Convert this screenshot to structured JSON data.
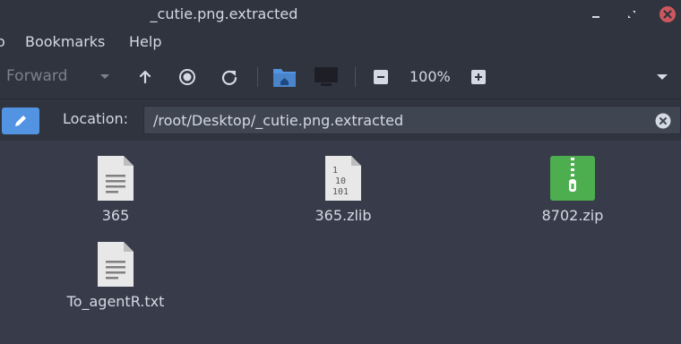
{
  "window": {
    "title": "_cutie.png.extracted"
  },
  "menubar": {
    "items": [
      "o",
      "Bookmarks",
      "Help"
    ]
  },
  "toolbar": {
    "forward_label": "Forward",
    "zoom_level": "100%"
  },
  "location": {
    "label": "Location:",
    "value": "/root/Desktop/_cutie.png.extracted"
  },
  "files": [
    {
      "name": "365",
      "icon": "text-file-icon"
    },
    {
      "name": "365.zlib",
      "icon": "binary-file-icon"
    },
    {
      "name": "8702.zip",
      "icon": "zip-archive-icon"
    },
    {
      "name": "To_agentR.txt",
      "icon": "text-file-icon"
    }
  ],
  "colors": {
    "accent": "#5294e2",
    "close": "#cc575d",
    "zip": "#4cae4f"
  }
}
